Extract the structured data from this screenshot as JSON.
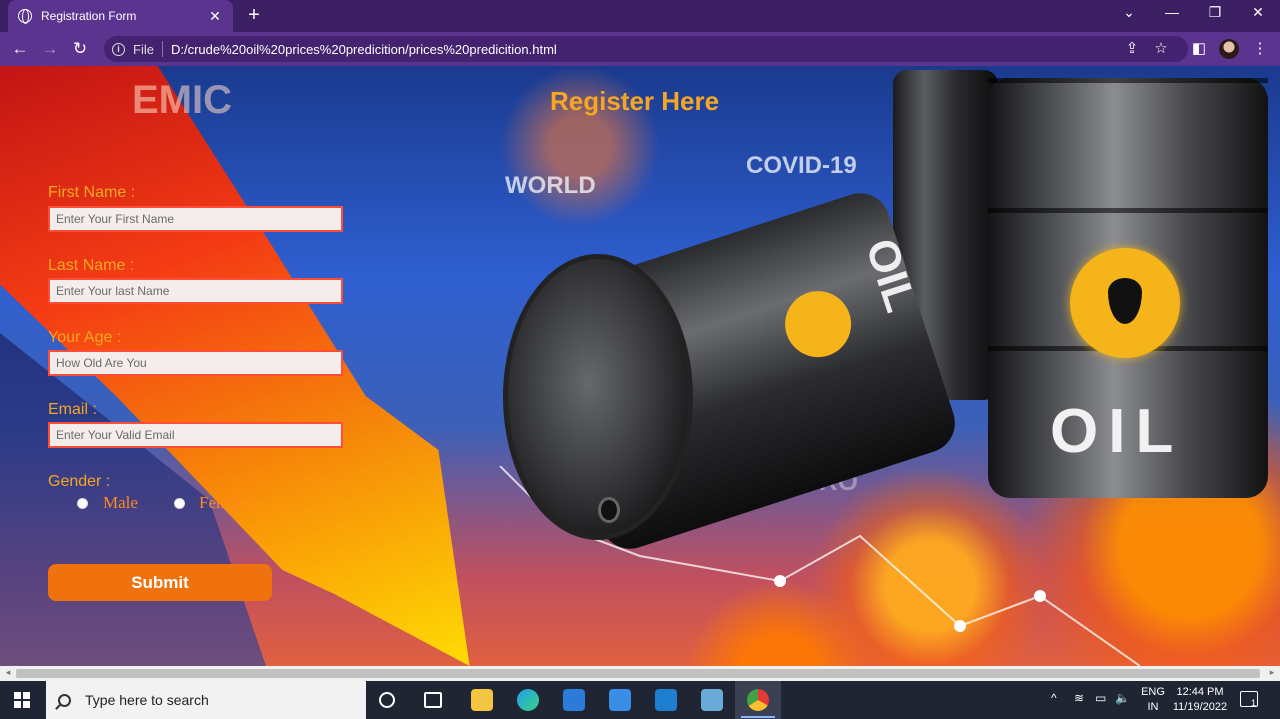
{
  "browser": {
    "tab_title": "Registration Form",
    "tab_close": "✕",
    "new_tab": "+",
    "window_controls": [
      "⌄",
      "—",
      "❐",
      "✕"
    ],
    "nav": {
      "back": "←",
      "forward": "→",
      "reload": "↻"
    },
    "address_scheme": "File",
    "address_info": "i",
    "url": "D:/crude%20oil%20prices%20predicition/prices%20predicition.html",
    "right_icons": [
      "share-icon",
      "star-icon",
      "side-panel-icon",
      "profile-avatar",
      "menu-icon"
    ],
    "right_glyphs": [
      "⇪",
      "☆",
      "◧",
      "⋮"
    ]
  },
  "background": {
    "words": [
      "EMIC",
      "WORLD",
      "COVID-19",
      "CORO"
    ],
    "barrel_text": [
      "OIL",
      "OIL"
    ]
  },
  "form": {
    "heading": "Register Here",
    "first_name": {
      "label": "First Name :",
      "placeholder": "Enter Your First Name",
      "value": ""
    },
    "last_name": {
      "label": "Last Name :",
      "placeholder": "Enter Your last Name",
      "value": ""
    },
    "age": {
      "label": "Your Age :",
      "placeholder": "How Old Are You",
      "value": ""
    },
    "email": {
      "label": "Email :",
      "placeholder": "Enter Your Valid Email",
      "value": ""
    },
    "gender": {
      "label": "Gender :",
      "options": [
        "Male",
        "Female"
      ],
      "selected": null
    },
    "submit_label": "Submit"
  },
  "taskbar": {
    "search_placeholder": "Type here to search",
    "apps": [
      "task-view-icon",
      "widgets-icon",
      "file-explorer-icon",
      "edge-icon",
      "store-icon",
      "mail-icon",
      "vscode-icon",
      "notepad-icon",
      "chrome-icon"
    ],
    "tray_glyphs": [
      "^",
      "≋",
      "▭",
      "🔈"
    ],
    "language": "ENG",
    "region": "IN",
    "time": "12:44 PM",
    "date": "11/19/2022",
    "notification_count": "1"
  },
  "colors": {
    "accent_orange": "#f5a623",
    "button_orange": "#f0720e",
    "input_border": "#ff4d3a",
    "chrome_purple": "#5b3490"
  }
}
